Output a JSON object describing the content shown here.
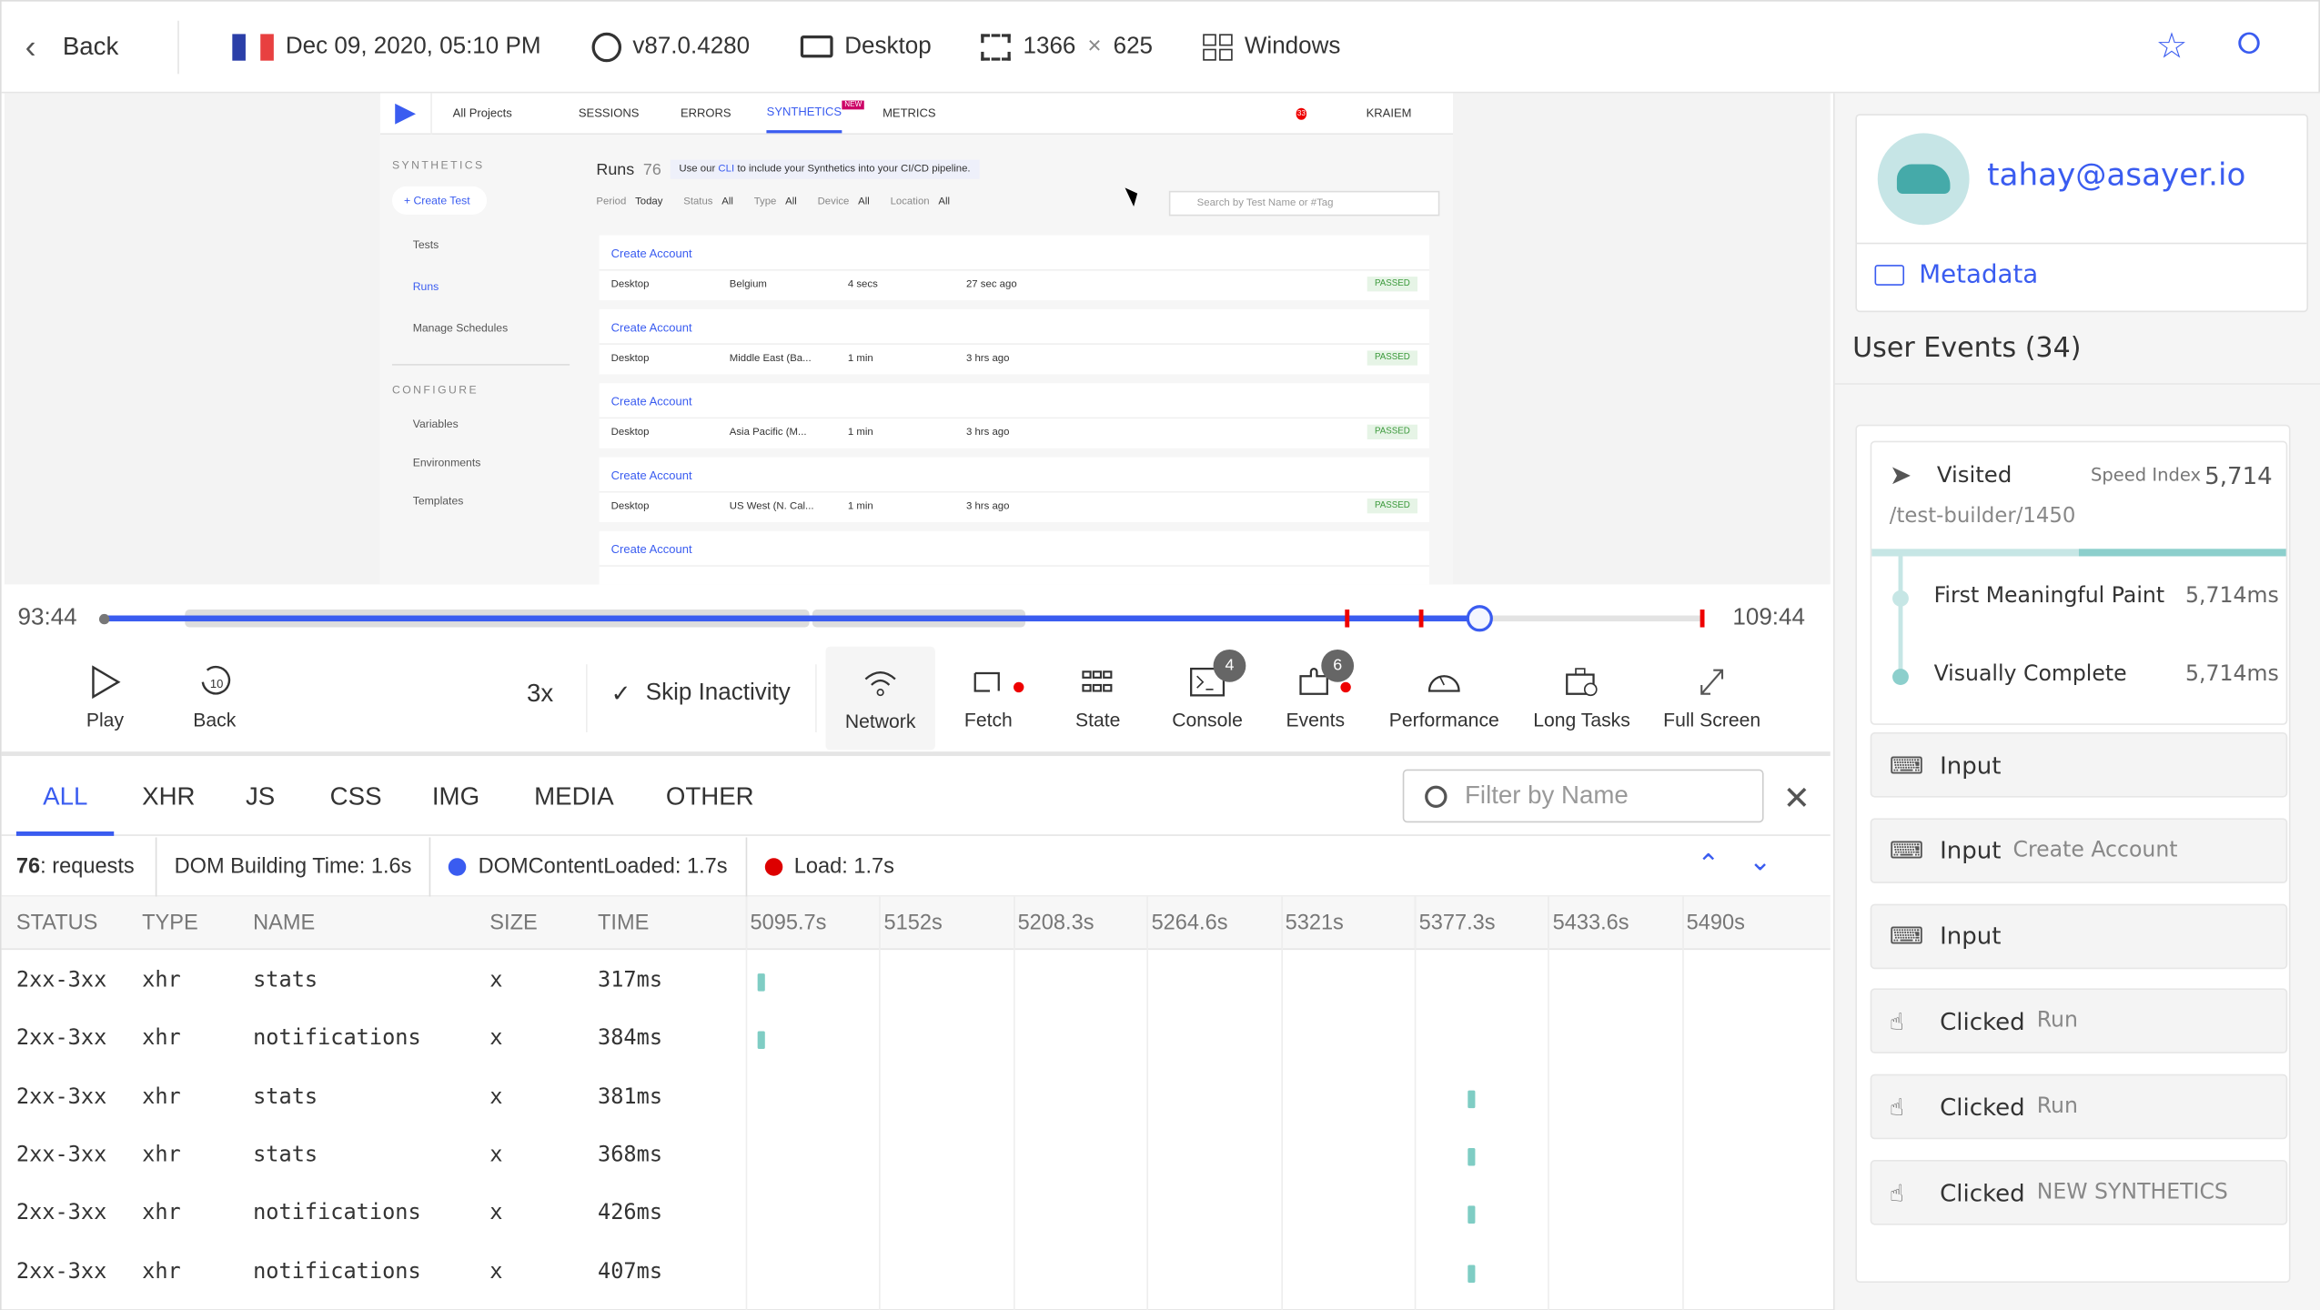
{
  "topbar": {
    "back": "Back",
    "datetime": "Dec 09, 2020, 05:10 PM",
    "browser": "v87.0.4280",
    "device": "Desktop",
    "resolution_w": "1366",
    "resolution_x": "×",
    "resolution_h": "625",
    "os": "Windows",
    "flag_colors": [
      "#2b3fa8",
      "#ffffff",
      "#e84040"
    ]
  },
  "replay": {
    "nav": {
      "projects": "All Projects",
      "sessions": "SESSIONS",
      "errors": "ERRORS",
      "synthetics": "SYNTHETICS",
      "new_badge": "NEW",
      "metrics": "METRICS",
      "user": "KRAIEM",
      "notif_count": "33"
    },
    "sidebar": {
      "section1": "SYNTHETICS",
      "create": "+ Create Test",
      "tests": "Tests",
      "runs": "Runs",
      "schedules": "Manage Schedules",
      "section2": "CONFIGURE",
      "variables": "Variables",
      "environments": "Environments",
      "templates": "Templates"
    },
    "runs_title": "Runs",
    "runs_count": "76",
    "info_pre": "Use our",
    "info_link": "CLI",
    "info_post": "to include your Synthetics into your CI/CD pipeline.",
    "filters": [
      {
        "label": "Period",
        "value": "Today"
      },
      {
        "label": "Status",
        "value": "All"
      },
      {
        "label": "Type",
        "value": "All"
      },
      {
        "label": "Device",
        "value": "All"
      },
      {
        "label": "Location",
        "value": "All"
      }
    ],
    "search_placeholder": "Search by Test Name or #Tag",
    "runs": [
      {
        "name": "Create Account",
        "device": "Desktop",
        "location": "Belgium",
        "duration": "4 secs",
        "ago": "27 sec ago",
        "status": "PASSED"
      },
      {
        "name": "Create Account",
        "device": "Desktop",
        "location": "Middle East (Ba...",
        "duration": "1 min",
        "ago": "3 hrs ago",
        "status": "PASSED"
      },
      {
        "name": "Create Account",
        "device": "Desktop",
        "location": "Asia Pacific (M...",
        "duration": "1 min",
        "ago": "3 hrs ago",
        "status": "PASSED"
      },
      {
        "name": "Create Account",
        "device": "Desktop",
        "location": "US West (N. Cal...",
        "duration": "1 min",
        "ago": "3 hrs ago",
        "status": "PASSED"
      },
      {
        "name": "Create Account",
        "device": "",
        "location": "",
        "duration": "",
        "ago": "",
        "status": ""
      }
    ]
  },
  "player": {
    "start": "93:44",
    "end": "109:44",
    "progress": 0.86,
    "speed": "3x",
    "skip": "Skip Inactivity",
    "controls": [
      {
        "id": "play",
        "label": "Play"
      },
      {
        "id": "back",
        "label": "Back"
      },
      {
        "id": "network",
        "label": "Network"
      },
      {
        "id": "fetch",
        "label": "Fetch"
      },
      {
        "id": "state",
        "label": "State"
      },
      {
        "id": "console",
        "label": "Console",
        "badge": "4"
      },
      {
        "id": "events",
        "label": "Events",
        "badge": "6"
      },
      {
        "id": "performance",
        "label": "Performance"
      },
      {
        "id": "longtasks",
        "label": "Long Tasks"
      },
      {
        "id": "fullscreen",
        "label": "Full Screen"
      }
    ]
  },
  "network": {
    "tabs": [
      "ALL",
      "XHR",
      "JS",
      "CSS",
      "IMG",
      "MEDIA",
      "OTHER"
    ],
    "active_tab": "ALL",
    "filter_placeholder": "Filter by Name",
    "summary": {
      "requests_count": "76",
      "requests_label": ": requests",
      "dom_building": "DOM Building Time: 1.6s",
      "dcl": "DOMContentLoaded: 1.7s",
      "load": "Load: 1.7s"
    },
    "columns": [
      "STATUS",
      "TYPE",
      "NAME",
      "SIZE",
      "TIME"
    ],
    "ticks": [
      "5095.7s",
      "5152s",
      "5208.3s",
      "5264.6s",
      "5321s",
      "5377.3s",
      "5433.6s",
      "5490s"
    ],
    "rows": [
      {
        "status": "2xx-3xx",
        "type": "xhr",
        "name": "stats",
        "size": "x",
        "time": "317ms",
        "start": 5101
      },
      {
        "status": "2xx-3xx",
        "type": "xhr",
        "name": "notifications",
        "size": "x",
        "time": "384ms",
        "start": 5101
      },
      {
        "status": "2xx-3xx",
        "type": "xhr",
        "name": "stats",
        "size": "x",
        "time": "381ms",
        "start": 5400
      },
      {
        "status": "2xx-3xx",
        "type": "xhr",
        "name": "stats",
        "size": "x",
        "time": "368ms",
        "start": 5400
      },
      {
        "status": "2xx-3xx",
        "type": "xhr",
        "name": "notifications",
        "size": "x",
        "time": "426ms",
        "start": 5400
      },
      {
        "status": "2xx-3xx",
        "type": "xhr",
        "name": "notifications",
        "size": "x",
        "time": "407ms",
        "start": 5400
      }
    ]
  },
  "panel": {
    "email": "tahay@asayer.io",
    "metadata": "Metadata",
    "events_title": "User Events (34)",
    "visit": {
      "label": "Visited",
      "speed_label": "Speed Index",
      "speed_value": "5,714",
      "path": "/test-builder/1450",
      "fmp_label": "First Meaningful Paint",
      "fmp": "5,714ms",
      "vc_label": "Visually Complete",
      "vc": "5,714ms"
    },
    "events": [
      {
        "type": "Input",
        "detail": ""
      },
      {
        "type": "Input",
        "detail": "Create Account"
      },
      {
        "type": "Input",
        "detail": ""
      },
      {
        "type": "Clicked",
        "detail": "Run"
      },
      {
        "type": "Clicked",
        "detail": "Run"
      },
      {
        "type": "Clicked",
        "detail": "NEW SYNTHETICS"
      }
    ]
  },
  "colors": {
    "accent": "#3a5cf0",
    "teal": "#7fcdc4",
    "error": "#e00000",
    "passed_bg": "#e6f4e6",
    "passed_fg": "#3c9a3c"
  }
}
